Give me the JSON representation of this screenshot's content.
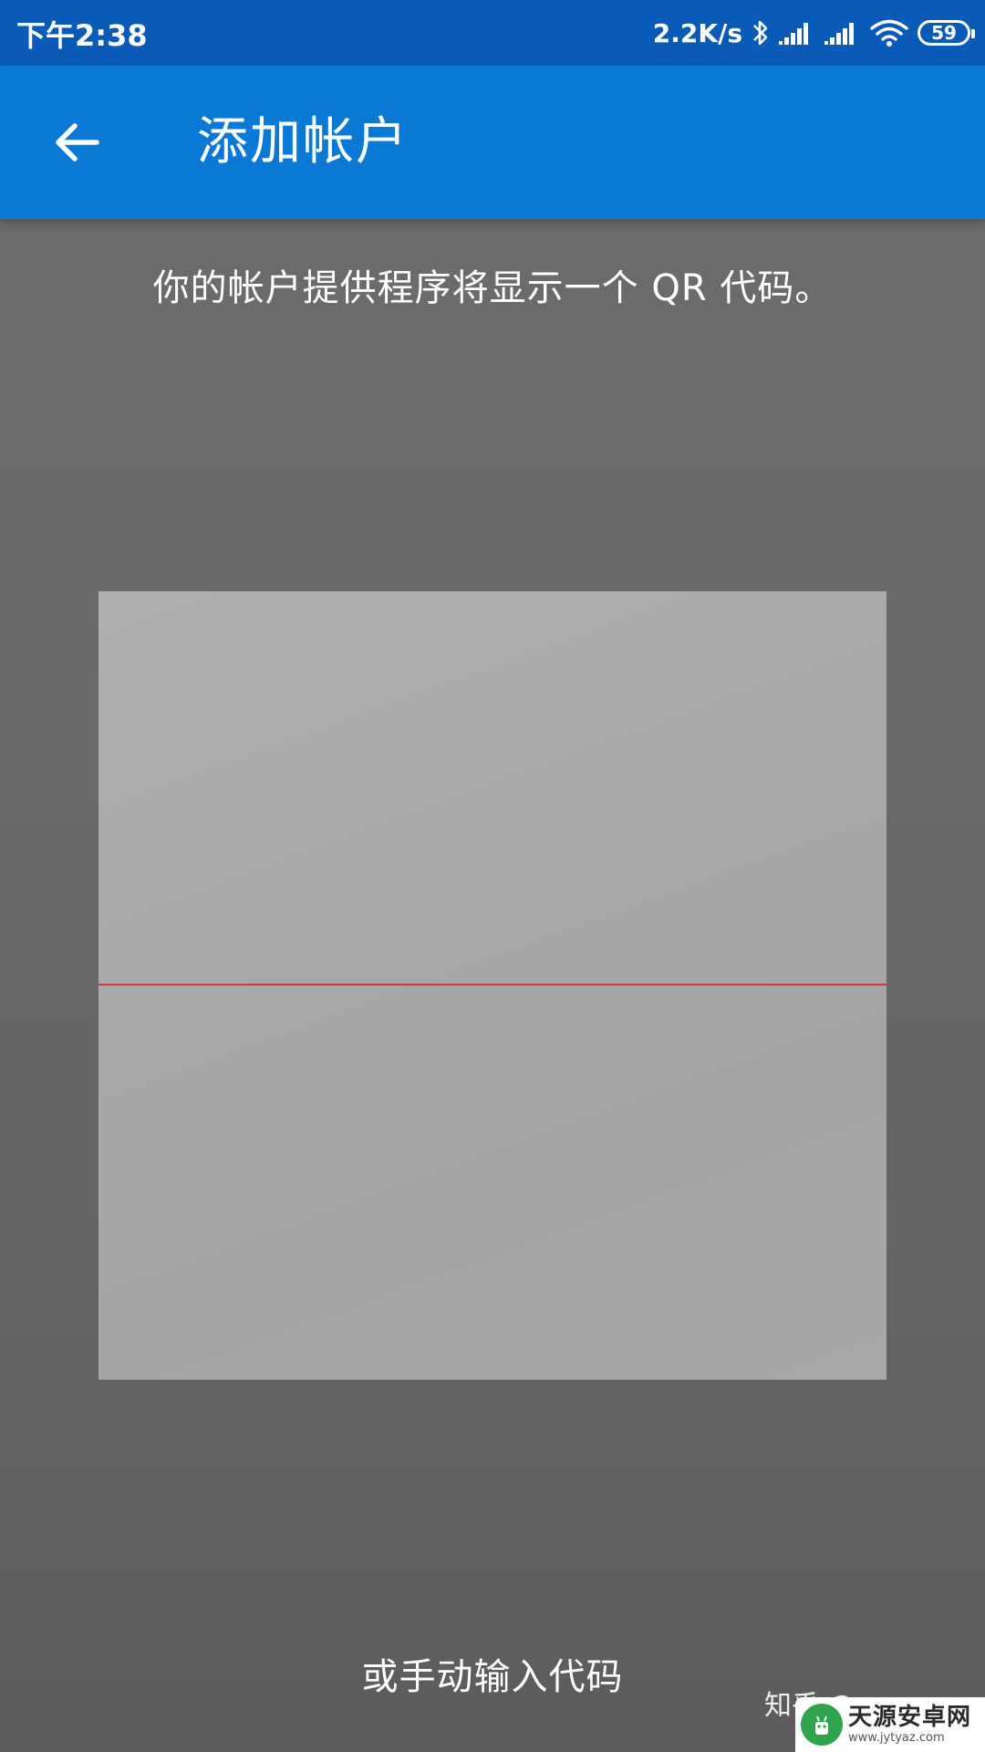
{
  "status_bar": {
    "time": "下午2:38",
    "network_speed": "2.2K/s",
    "battery_level": "59",
    "icons": [
      "bluetooth-icon",
      "signal-icon",
      "signal-icon",
      "wifi-icon",
      "battery-icon"
    ]
  },
  "app_bar": {
    "title": "添加帐户",
    "back_icon": "arrow-left-icon"
  },
  "scanner": {
    "instruction": "你的帐户提供程序将显示一个 QR 代码。",
    "scan_line_color": "#d23a2b"
  },
  "manual_entry_label": "或手动输入代码",
  "watermark": {
    "zhihu_text": "知乎 @",
    "site_name": "天源安卓网",
    "site_url": "www.jytyaz.com"
  },
  "colors": {
    "status_bar": "#0a5bb7",
    "app_bar": "#0a79d6",
    "background": "#6a6a6a",
    "scan_area": "#aaa8a8"
  }
}
